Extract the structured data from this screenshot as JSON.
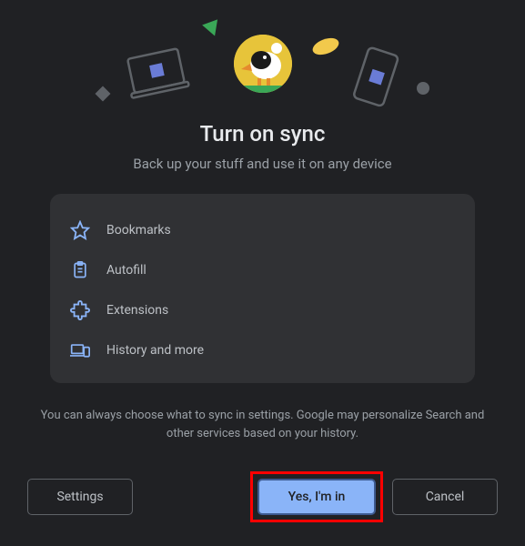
{
  "title": "Turn on sync",
  "subtitle": "Back up your stuff and use it on any device",
  "sync_items": {
    "bookmarks": "Bookmarks",
    "autofill": "Autofill",
    "extensions": "Extensions",
    "history": "History and more"
  },
  "footnote": "You can always choose what to sync in settings. Google may personalize Search and other services based on your history.",
  "buttons": {
    "settings": "Settings",
    "primary": "Yes, I'm in",
    "cancel": "Cancel"
  },
  "icons": {
    "bookmarks": "star-icon",
    "autofill": "clipboard-icon",
    "extensions": "puzzle-icon",
    "history": "devices-icon"
  },
  "colors": {
    "accent": "#8ab4f8",
    "background": "#202124",
    "card": "#303134",
    "highlight_border": "#ff0000"
  }
}
